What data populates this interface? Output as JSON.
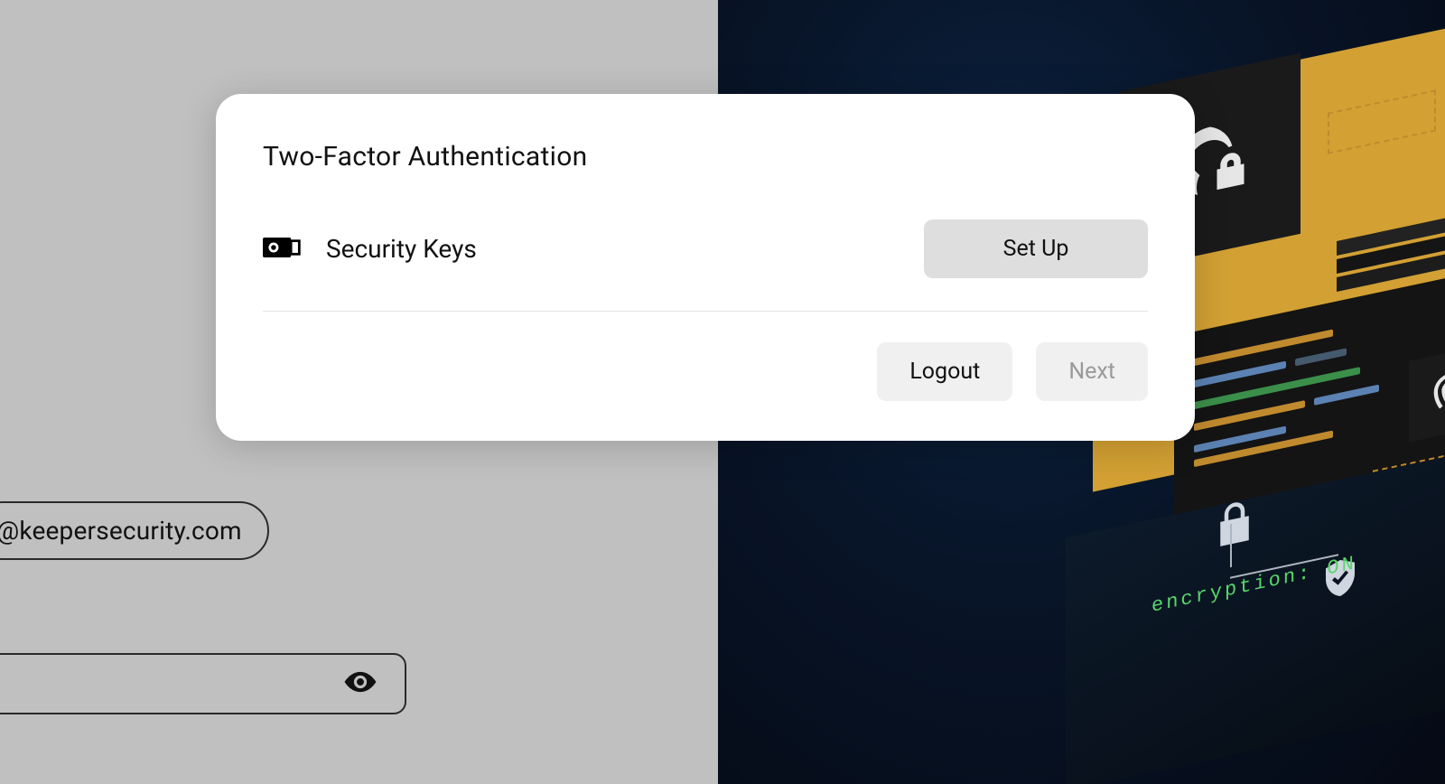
{
  "background": {
    "email_text": "@keepersecurity.com",
    "encryption_label": "encryption: ON"
  },
  "modal": {
    "title": "Two-Factor Authentication",
    "method": {
      "label": "Security Keys",
      "setup_button": "Set Up"
    },
    "footer": {
      "logout": "Logout",
      "next": "Next"
    }
  }
}
